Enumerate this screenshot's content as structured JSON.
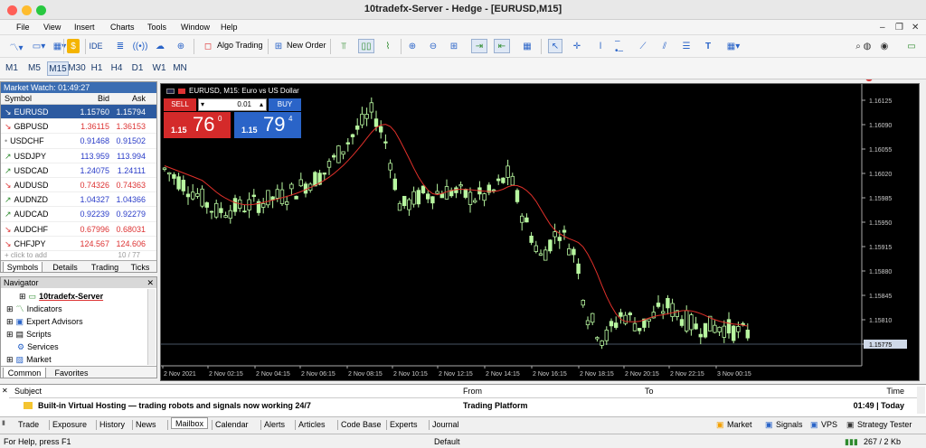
{
  "window": {
    "title": "10tradefx-Server - Hedge - [EURUSD,M15]"
  },
  "menu": [
    "File",
    "View",
    "Insert",
    "Charts",
    "Tools",
    "Window",
    "Help"
  ],
  "toolbar": {
    "algo": "Algo Trading",
    "new_order": "New Order",
    "ide": "IDE"
  },
  "timeframes": [
    "M1",
    "M5",
    "M15",
    "M30",
    "H1",
    "H4",
    "D1",
    "W1",
    "MN"
  ],
  "active_tf": "M15",
  "market_watch": {
    "title": "Market Watch: 01:49:27",
    "headers": [
      "Symbol",
      "Bid",
      "Ask"
    ],
    "rows": [
      {
        "s": "EURUSD",
        "b": "1.15760",
        "a": "1.15794",
        "dir": "down"
      },
      {
        "s": "GBPUSD",
        "b": "1.36115",
        "a": "1.36153",
        "dir": "down"
      },
      {
        "s": "USDCHF",
        "b": "0.91468",
        "a": "0.91502",
        "dir": "flat"
      },
      {
        "s": "USDJPY",
        "b": "113.959",
        "a": "113.994",
        "dir": "up"
      },
      {
        "s": "USDCAD",
        "b": "1.24075",
        "a": "1.24111",
        "dir": "up"
      },
      {
        "s": "AUDUSD",
        "b": "0.74326",
        "a": "0.74363",
        "dir": "down"
      },
      {
        "s": "AUDNZD",
        "b": "1.04327",
        "a": "1.04366",
        "dir": "up"
      },
      {
        "s": "AUDCAD",
        "b": "0.92239",
        "a": "0.92279",
        "dir": "up"
      },
      {
        "s": "AUDCHF",
        "b": "0.67996",
        "a": "0.68031",
        "dir": "down"
      },
      {
        "s": "CHFJPY",
        "b": "124.567",
        "a": "124.606",
        "dir": "down"
      }
    ],
    "add": "+ click to add",
    "count": "10 / 77",
    "tabs": [
      "Symbols",
      "Details",
      "Trading",
      "Ticks"
    ]
  },
  "navigator": {
    "title": "Navigator",
    "items": [
      "10tradefx-Server",
      "Indicators",
      "Expert Advisors",
      "Scripts",
      "Services",
      "Market"
    ],
    "tabs": [
      "Common",
      "Favorites"
    ]
  },
  "chart": {
    "label": "EURUSD, M15:  Euro vs US Dollar",
    "sell": "SELL",
    "buy": "BUY",
    "volume": "0.01",
    "sell_big": "1.15",
    "sell_pts": "76",
    "sell_sup": "0",
    "buy_big": "1.15",
    "buy_pts": "79",
    "buy_sup": "4",
    "price_labels": [
      "1.16125",
      "1.16090",
      "1.16055",
      "1.16020",
      "1.15985",
      "1.15950",
      "1.15915",
      "1.15880",
      "1.15845",
      "1.15810",
      "1.15775"
    ],
    "time_labels": [
      "2 Nov 2021",
      "2 Nov 02:15",
      "2 Nov 04:15",
      "2 Nov 06:15",
      "2 Nov 08:15",
      "2 Nov 10:15",
      "2 Nov 12:15",
      "2 Nov 14:15",
      "2 Nov 16:15",
      "2 Nov 18:15",
      "2 Nov 20:15",
      "2 Nov 22:15",
      "3 Nov 00:15"
    ],
    "current_price": "1.15775"
  },
  "mailbox": {
    "headers": [
      "Subject",
      "From",
      "To",
      "Time"
    ],
    "subject": "Built-in Virtual Hosting — trading robots and signals now working 24/7",
    "from": "Trading Platform",
    "time": "01:49 | Today"
  },
  "bottom_tabs": [
    "Trade",
    "Exposure",
    "History",
    "News",
    "Mailbox",
    "Calendar",
    "Alerts",
    "Articles",
    "Code Base",
    "Experts",
    "Journal"
  ],
  "bottom_right": [
    "Market",
    "Signals",
    "VPS",
    "Strategy Tester"
  ],
  "status": {
    "help": "For Help, press F1",
    "profile": "Default",
    "traffic": "267 / 2 Kb"
  }
}
